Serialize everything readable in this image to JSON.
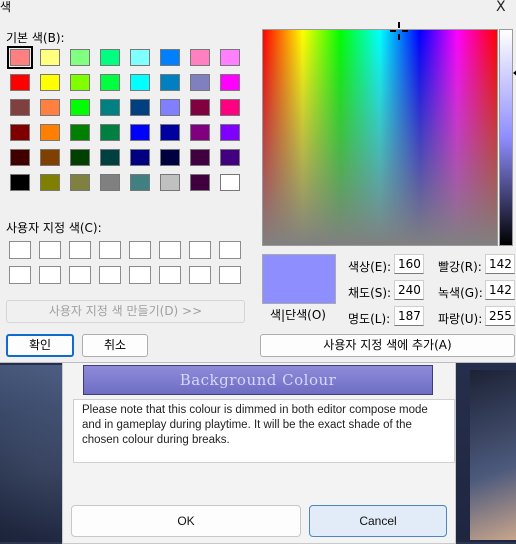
{
  "dialog": {
    "title": "색",
    "close_label": "X",
    "basic_label": "기본 색(B):",
    "custom_label": "사용자 지정 색(C):",
    "define_button": "사용자 지정 색 만들기(D) >>",
    "ok_button": "확인",
    "cancel_button": "취소",
    "preview_label": "색|단색(O)",
    "add_button": "사용자 지정 색에 추가(A)",
    "fields": {
      "hue_label": "색상(E):",
      "hue": "160",
      "sat_label": "채도(S):",
      "sat": "240",
      "lum_label": "명도(L):",
      "lum": "187",
      "red_label": "빨강(R):",
      "red": "142",
      "green_label": "녹색(G):",
      "green": "142",
      "blue_label": "파랑(U):",
      "blue": "255"
    },
    "current_color": "#8E8EFF",
    "basic_colors": [
      "#FF8080",
      "#FFFF80",
      "#80FF80",
      "#00FF80",
      "#80FFFF",
      "#0080FF",
      "#FF80C0",
      "#FF80FF",
      "#FF0000",
      "#FFFF00",
      "#80FF00",
      "#00FF40",
      "#00FFFF",
      "#0080C0",
      "#8080C0",
      "#FF00FF",
      "#804040",
      "#FF8040",
      "#00FF00",
      "#008080",
      "#004080",
      "#8080FF",
      "#800040",
      "#FF0080",
      "#800000",
      "#FF8000",
      "#008000",
      "#008040",
      "#0000FF",
      "#0000A0",
      "#800080",
      "#8000FF",
      "#400000",
      "#804000",
      "#004000",
      "#004040",
      "#000080",
      "#000040",
      "#400040",
      "#400080",
      "#000000",
      "#808000",
      "#808040",
      "#808080",
      "#408080",
      "#C0C0C0",
      "#400040",
      "#FFFFFF"
    ],
    "selected_index": 0
  },
  "underlying": {
    "header_button": "Background Colour",
    "note": "Please note that this colour is dimmed in both editor compose mode and in gameplay during playtime.  It will be the exact shade of the chosen colour during breaks.",
    "ok_button": "OK",
    "cancel_button": "Cancel"
  }
}
